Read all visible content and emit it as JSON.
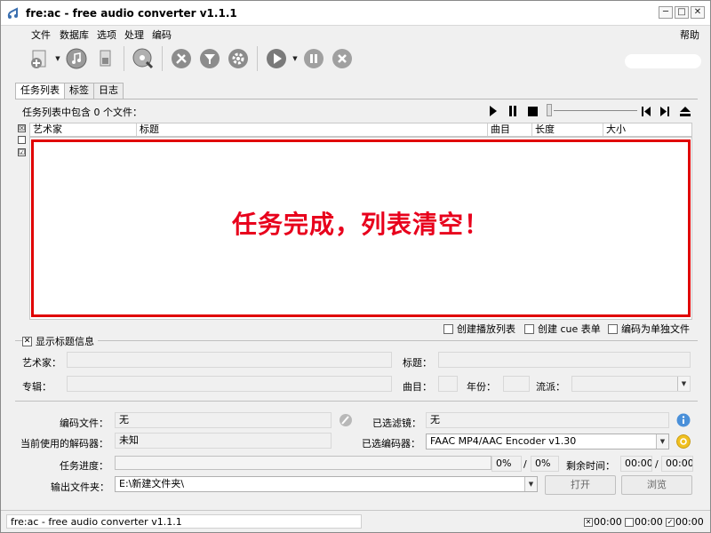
{
  "window": {
    "title": "fre:ac - free audio converter v1.1.1",
    "controls": {
      "minimize": "─",
      "maximize": "□",
      "close": "✕"
    }
  },
  "menu": {
    "items": [
      "文件",
      "数据库",
      "选项",
      "处理",
      "编码"
    ],
    "help": "帮助"
  },
  "toolbar": {
    "icons": [
      "add-files-icon",
      "cdda-icon",
      "cd-ripper-icon",
      "cddb-query-icon",
      "settings-icon",
      "filter-icon",
      "configure-icon",
      "encode-icon",
      "pause-icon",
      "stop-icon"
    ]
  },
  "tabs": [
    "任务列表",
    "标签",
    "日志"
  ],
  "joblist": {
    "summary": "任务列表中包含 0 个文件：",
    "columns": [
      "艺术家",
      "标题",
      "曲目",
      "长度",
      "大小"
    ],
    "side_checks": [
      "☒",
      "",
      "☑"
    ]
  },
  "overlay": {
    "message": "任务完成，列表清空！",
    "color": "#e8001c"
  },
  "options": {
    "create_playlist": "创建播放列表",
    "create_cue": "创建 cue 表单",
    "encode_single": "编码为单独文件"
  },
  "title_info": {
    "toggle_label": "显示标题信息",
    "artist_label": "艺术家：",
    "title_label": "标题：",
    "album_label": "专辑：",
    "track_label": "曲目：",
    "year_label": "年份：",
    "genre_label": "流派："
  },
  "status": {
    "encoding_file_label": "编码文件：",
    "encoding_file_value": "无",
    "decoder_label": "当前使用的解码器：",
    "decoder_value": "未知",
    "filters_label": "已选滤镜：",
    "filters_value": "无",
    "encoder_label": "已选编码器：",
    "encoder_value": "FAAC MP4/AAC Encoder v1.30",
    "progress_label": "任务进度：",
    "progress_value": 0,
    "percent_1": "0%",
    "percent_sep": "/",
    "percent_2": "0%",
    "remaining_label": "剩余时间：",
    "time_1": "00:00",
    "time_sep": "/",
    "time_2": "00:00",
    "output_label": "输出文件夹：",
    "output_value": "E:\\新建文件夹\\",
    "open_button": "打开",
    "browse_button": "浏览"
  },
  "statusbar": {
    "text": "fre:ac - free audio converter v1.1.1",
    "times": [
      "00:00",
      "00:00",
      "00:00"
    ]
  }
}
